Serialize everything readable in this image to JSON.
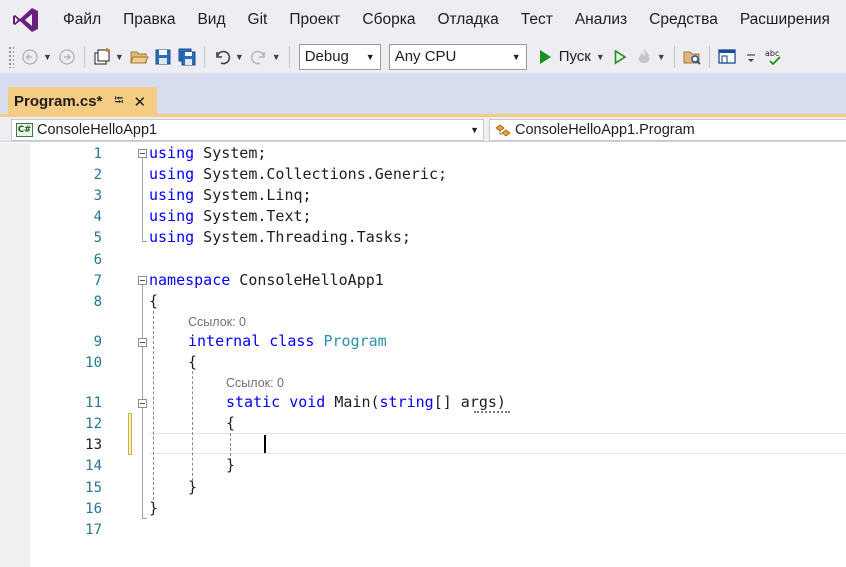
{
  "menu": [
    "Файл",
    "Правка",
    "Вид",
    "Git",
    "Проект",
    "Сборка",
    "Отладка",
    "Тест",
    "Анализ",
    "Средства",
    "Расширения"
  ],
  "toolbar": {
    "configuration": "Debug",
    "platform": "Any CPU",
    "run_label": "Пуск"
  },
  "document_tab": {
    "title": "Program.cs*"
  },
  "navigation": {
    "project": "ConsoleHelloApp1",
    "project_badge": "C#",
    "type": "ConsoleHelloApp1.Program"
  },
  "editor": {
    "line_numbers": [
      "1",
      "2",
      "3",
      "4",
      "5",
      "6",
      "7",
      "8",
      "9",
      "10",
      "11",
      "12",
      "13",
      "14",
      "15",
      "16",
      "17"
    ],
    "current_line": "13",
    "codelens": {
      "program_refs": "Ссылок: 0",
      "main_refs": "Ссылок: 0"
    },
    "code": {
      "l1_kw": "using",
      "l1_rest": " System;",
      "l2_kw": "using",
      "l2_rest": " System.Collections.Generic;",
      "l3_kw": "using",
      "l3_rest": " System.Linq;",
      "l4_kw": "using",
      "l4_rest": " System.Text;",
      "l5_kw": "using",
      "l5_rest": " System.Threading.Tasks;",
      "l7_kw": "namespace",
      "l7_rest": " ConsoleHelloApp1",
      "l8": "{",
      "l9_kw1": "internal",
      "l9_kw2": "class",
      "l9_type": "Program",
      "l10": "{",
      "l11_kw1": "static",
      "l11_kw2": "void",
      "l11_name": "Main",
      "l11_open": "(",
      "l11_kw3": "string",
      "l11_rest": "[] args)",
      "l12": "{",
      "l14": "}",
      "l15": "}",
      "l16": "}"
    }
  },
  "colors": {
    "keyword": "#0000ff",
    "type": "#2b91af",
    "line_number": "#237893",
    "active_tab": "#f5cc84",
    "vs_logo": "#68217a"
  }
}
